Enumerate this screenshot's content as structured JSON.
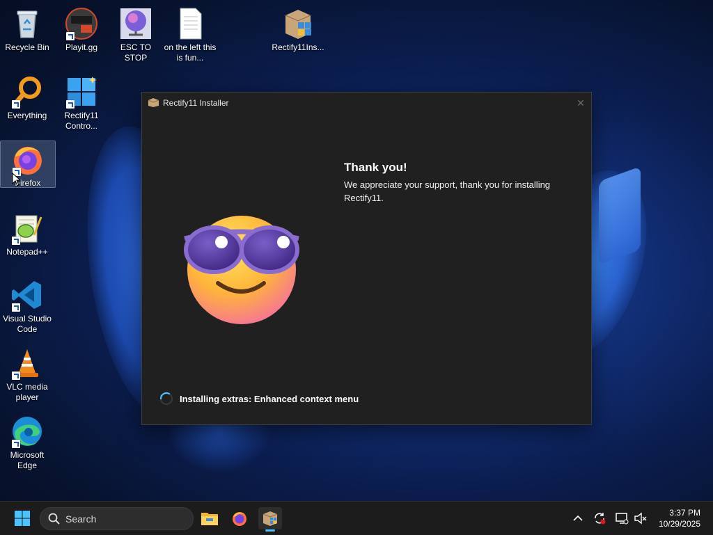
{
  "desktop": {
    "icons": [
      {
        "label": "Recycle Bin"
      },
      {
        "label": "Playit.gg",
        "badge": "PLAYIT GG"
      },
      {
        "label": "ESC TO STOP"
      },
      {
        "label": "on the left this is fun..."
      },
      {
        "label": "Rectify11Ins..."
      },
      {
        "label": "Everything"
      },
      {
        "label": "Rectify11 Contro..."
      },
      {
        "label": "Firefox"
      },
      {
        "label": "Notepad++"
      },
      {
        "label": "Visual Studio Code"
      },
      {
        "label": "VLC media player"
      },
      {
        "label": "Microsoft Edge"
      }
    ]
  },
  "installer": {
    "title": "Rectify11 Installer",
    "close_glyph": "✕",
    "heading": "Thank you!",
    "message": "We appreciate your support, thank you for installing Rectify11.",
    "status": "Installing extras: Enhanced context menu"
  },
  "taskbar": {
    "search_placeholder": "Search",
    "apps": [
      "start-button",
      "search",
      "file-explorer",
      "firefox",
      "rectify11-installer"
    ],
    "active_app": "rectify11-installer",
    "tray": [
      "chevron-up-icon",
      "sync-icon",
      "network-icon",
      "volume-muted-icon"
    ],
    "time": "3:37 PM",
    "date": "10/29/2025"
  },
  "colors": {
    "window_bg": "#202020",
    "accent": "#4cc2ff",
    "taskbar_bg": "#1c1c1c"
  }
}
